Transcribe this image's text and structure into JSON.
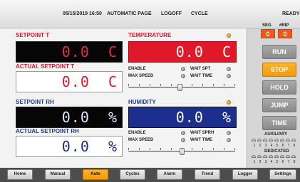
{
  "header": {
    "datetime": "05/15/2019 16:50",
    "page": "AUTOMATIC PAGE",
    "logoff": "LOGOFF",
    "cycle": "CYCLE",
    "status": "READY"
  },
  "temp": {
    "setpoint_label": "SETPOINT T",
    "setpoint_value": "0.0",
    "setpoint_unit": "C",
    "actual_label": "ACTUAL SETPOINT T",
    "actual_value": "0.0",
    "actual_unit": "C",
    "title": "TEMPERATURE",
    "value": "0.0",
    "unit": "C",
    "enable": "ENABLE",
    "wait_spt": "WAIT SPT",
    "max_speed": "MAX SPEED",
    "wait_time": "WAIT TIME",
    "slider_fraction": 0.48
  },
  "hum": {
    "setpoint_label": "SETPOINT RH",
    "setpoint_value": "0.0",
    "setpoint_unit": "%",
    "actual_label": "ACTUAL SETPOINT RH",
    "actual_value": "0.0",
    "actual_unit": "%",
    "title": "HUMIDITY",
    "value": "0.0",
    "unit": "%",
    "enable": "ENABLE",
    "wait_sprh": "WAIT SPRH",
    "max_speed": "MAX SPEED",
    "wait_time": "WAIT TIME",
    "slider_fraction": 0.5
  },
  "side": {
    "seg_label": "SEG",
    "rip_label": "#RIP",
    "seg_value": "0",
    "rip_value": "0",
    "run": "RUN",
    "stop": "STOP",
    "hold": "HOLD",
    "jump": "JUMP",
    "time": "TIME",
    "auxiliary": "AUXILIARY",
    "dedicated": "DEDICATED",
    "numbers": [
      "1",
      "2",
      "3",
      "4",
      "5",
      "6",
      "7",
      "8"
    ]
  },
  "nav": {
    "home": "Home",
    "manual": "Manual",
    "auto": "Auto",
    "cycles": "Cycles",
    "alarm": "Alarm",
    "trend": "Trend",
    "logger": "Logger",
    "settings": "Settings"
  },
  "colors": {
    "accent": "#f29b0d",
    "alarm_red": "#e0192a",
    "hum_blue": "#1c2f8e"
  }
}
